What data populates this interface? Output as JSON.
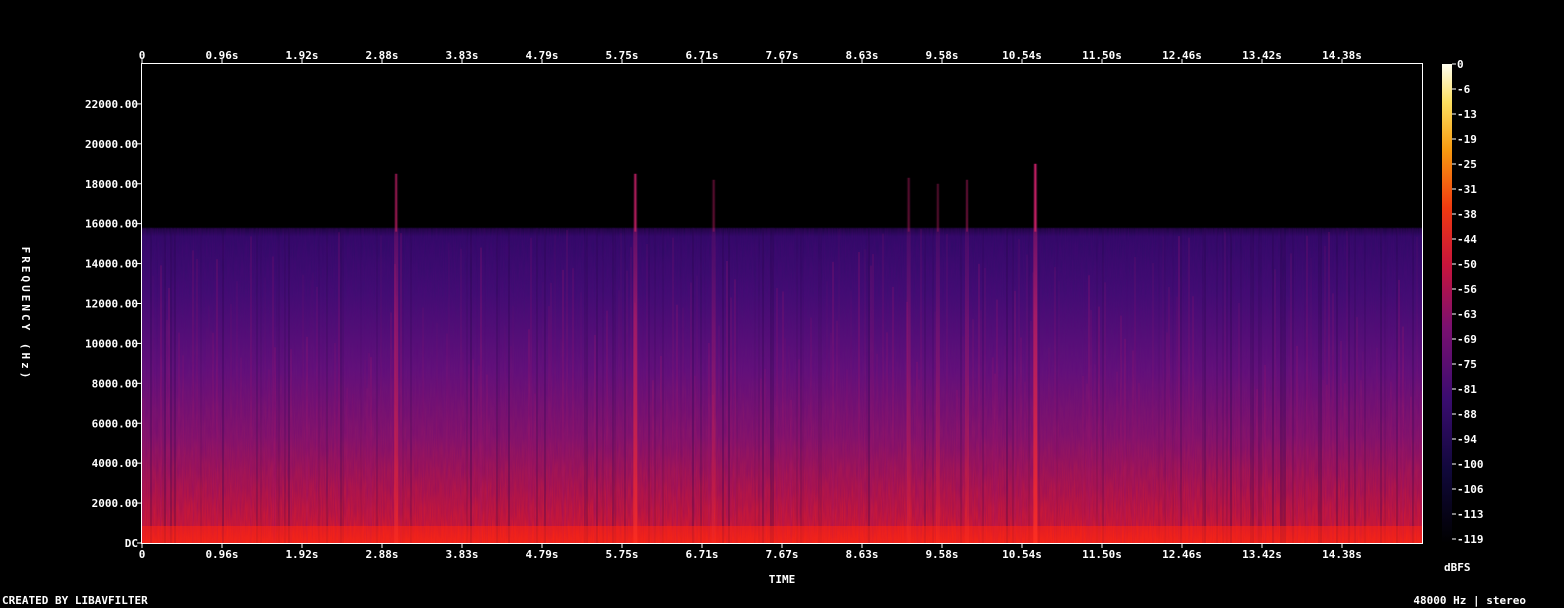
{
  "chart_data": {
    "type": "heatmap",
    "title": "",
    "xlabel": "TIME",
    "ylabel": "FREQUENCY (Hz)",
    "x_ticks": [
      "0",
      "0.96s",
      "1.92s",
      "2.88s",
      "3.83s",
      "4.79s",
      "5.75s",
      "6.71s",
      "7.67s",
      "8.63s",
      "9.58s",
      "10.54s",
      "11.50s",
      "12.46s",
      "13.42s",
      "14.38s"
    ],
    "x_ticks_bottom": [
      "0",
      "0.96s",
      "1.92s",
      "2.88s",
      "3.83s",
      "4.79s",
      "5.75s",
      "6.71s",
      "7.67s",
      "8.63s",
      "9.58s",
      "10.54s",
      "11.50s",
      "12.46s",
      "13.42s",
      "14.38s"
    ],
    "xlim": [
      0,
      15.36
    ],
    "y_ticks": [
      "DC",
      "2000.00",
      "4000.00",
      "6000.00",
      "8000.00",
      "10000.00",
      "12000.00",
      "14000.00",
      "16000.00",
      "18000.00",
      "20000.00",
      "22000.00"
    ],
    "y_tick_values": [
      0,
      2000,
      4000,
      6000,
      8000,
      10000,
      12000,
      14000,
      16000,
      18000,
      20000,
      22000
    ],
    "ylim": [
      0,
      24000
    ],
    "colorbar": {
      "label": "dBFS",
      "ticks": [
        "0",
        "-6",
        "-13",
        "-19",
        "-25",
        "-31",
        "-38",
        "-44",
        "-50",
        "-56",
        "-63",
        "-69",
        "-75",
        "-81",
        "-88",
        "-94",
        "-100",
        "-106",
        "-113",
        "-119"
      ],
      "range": [
        -119,
        0
      ]
    },
    "spectral_cutoff_hz": 15800,
    "transients": [
      {
        "t": 3.05,
        "top_hz": 18500,
        "strength": 0.6
      },
      {
        "t": 5.92,
        "top_hz": 18500,
        "strength": 0.8
      },
      {
        "t": 6.86,
        "top_hz": 18200,
        "strength": 0.35
      },
      {
        "t": 9.2,
        "top_hz": 18300,
        "strength": 0.35
      },
      {
        "t": 9.55,
        "top_hz": 18000,
        "strength": 0.3
      },
      {
        "t": 9.9,
        "top_hz": 18200,
        "strength": 0.35
      },
      {
        "t": 10.72,
        "top_hz": 19000,
        "strength": 0.95
      }
    ]
  },
  "footer": {
    "left": "CREATED BY LIBAVFILTER",
    "right": "48000 Hz | stereo"
  },
  "colors": {
    "background": "#000000",
    "low": "#0a0628",
    "mid": "#5a1488",
    "high": "#e62020",
    "peak": "#ffffd0"
  }
}
